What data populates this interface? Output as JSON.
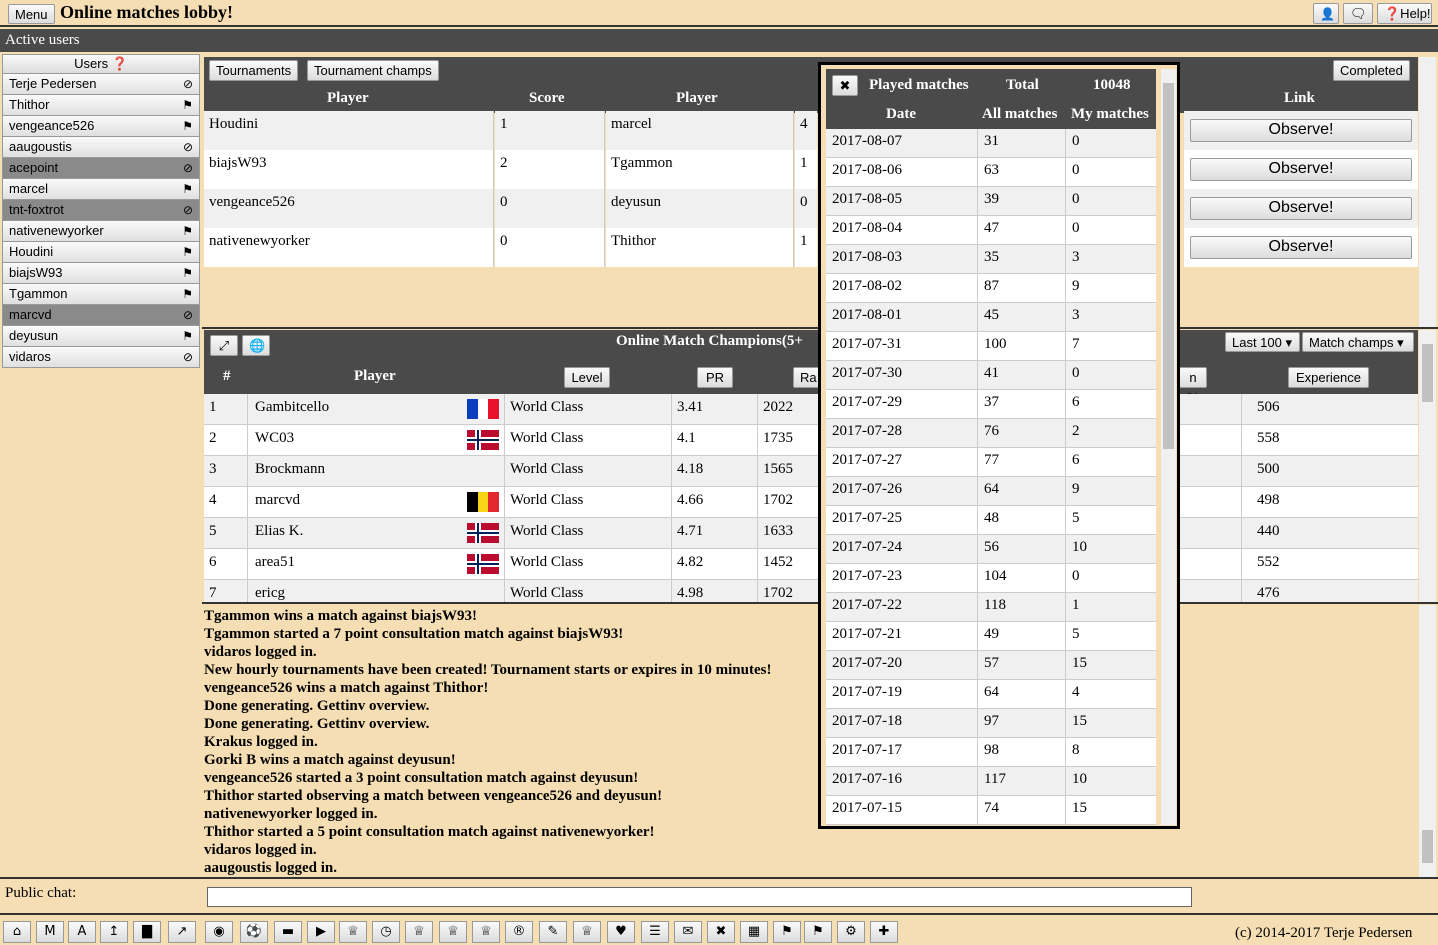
{
  "header": {
    "menu_label": "Menu",
    "title": "Online matches lobby!",
    "help_label": "❓Help!"
  },
  "active_users_label": "Active users",
  "users_header": "Users ❓",
  "users": [
    {
      "name": "Terje Pedersen",
      "icon": "⊘",
      "dark": false
    },
    {
      "name": "Thithor",
      "icon": "⚑",
      "dark": false
    },
    {
      "name": "vengeance526",
      "icon": "⚑",
      "dark": false
    },
    {
      "name": "aaugoustis",
      "icon": "⊘",
      "dark": false
    },
    {
      "name": "acepoint",
      "icon": "⊘",
      "dark": true
    },
    {
      "name": "marcel",
      "icon": "⚑",
      "dark": false
    },
    {
      "name": "tnt-foxtrot",
      "icon": "⊘",
      "dark": true
    },
    {
      "name": "nativenewyorker",
      "icon": "⚑",
      "dark": false
    },
    {
      "name": "Houdini",
      "icon": "⚑",
      "dark": false
    },
    {
      "name": "biajsW93",
      "icon": "⚑",
      "dark": false
    },
    {
      "name": "Tgammon",
      "icon": "⚑",
      "dark": false
    },
    {
      "name": "marcvd",
      "icon": "⊘",
      "dark": true
    },
    {
      "name": "deyusun",
      "icon": "⚑",
      "dark": false
    },
    {
      "name": "vidaros",
      "icon": "⊘",
      "dark": false
    }
  ],
  "matches": {
    "tab_tournaments": "Tournaments",
    "tab_champs": "Tournament champs",
    "completed": "Completed",
    "col_player1": "Player",
    "col_score": "Score",
    "col_player2": "Player",
    "col_link": "Link",
    "observe_label": "Observe!",
    "rows": [
      {
        "p1": "Houdini",
        "s1": "1",
        "p2": "marcel",
        "s2": "4"
      },
      {
        "p1": "biajsW93",
        "s1": "2",
        "p2": "Tgammon",
        "s2": "1"
      },
      {
        "p1": "vengeance526",
        "s1": "0",
        "p2": "deyusun",
        "s2": "0"
      },
      {
        "p1": "nativenewyorker",
        "s1": "0",
        "p2": "Thithor",
        "s2": "1"
      }
    ]
  },
  "champs": {
    "title": "Online Match Champions(5+",
    "select1": "Last 100 ▾",
    "select2": "Match champs ▾",
    "col_num": "#",
    "col_player": "Player",
    "btn_level": "Level",
    "btn_pr": "PR",
    "btn_ra": "Ra",
    "btn_pct": "n %",
    "btn_exp": "Experience",
    "rows": [
      {
        "n": "1",
        "player": "Gambitcello",
        "flag": "fr",
        "level": "World Class",
        "pr": "3.41",
        "ra": "2022",
        "exp": "506"
      },
      {
        "n": "2",
        "player": "WC03",
        "flag": "no",
        "level": "World Class",
        "pr": "4.1",
        "ra": "1735",
        "exp": "558"
      },
      {
        "n": "3",
        "player": "Brockmann",
        "flag": "",
        "level": "World Class",
        "pr": "4.18",
        "ra": "1565",
        "exp": "500"
      },
      {
        "n": "4",
        "player": "marcvd",
        "flag": "be",
        "level": "World Class",
        "pr": "4.66",
        "ra": "1702",
        "exp": "498"
      },
      {
        "n": "5",
        "player": "Elias K.",
        "flag": "no",
        "level": "World Class",
        "pr": "4.71",
        "ra": "1633",
        "exp": "440"
      },
      {
        "n": "6",
        "player": "area51",
        "flag": "no",
        "level": "World Class",
        "pr": "4.82",
        "ra": "1452",
        "exp": "552"
      },
      {
        "n": "7",
        "player": "ericg",
        "flag": "",
        "level": "World Class",
        "pr": "4.98",
        "ra": "1702",
        "exp": "476"
      }
    ]
  },
  "log": [
    "Tgammon wins a match against biajsW93!",
    "Tgammon started a 7 point consultation match against biajsW93!",
    "vidaros logged in.",
    "New hourly tournaments have been created! Tournament starts or expires in 10 minutes!",
    "vengeance526 wins a match against Thithor!",
    "Done generating. Gettinv overview.",
    "Done generating. Gettinv overview.",
    "Krakus logged in.",
    "Gorki B wins a match against deyusun!",
    "vengeance526 started a 3 point consultation match against deyusun!",
    "Thithor started observing a match between vengeance526 and deyusun!",
    "nativenewyorker logged in.",
    "Thithor started a 5 point consultation match against nativenewyorker!",
    "vidaros logged in.",
    "aaugoustis logged in."
  ],
  "chat": {
    "label": "Public chat:",
    "value": ""
  },
  "played": {
    "close": "✖",
    "title": "Played matches",
    "total_label": "Total",
    "total": "10048",
    "col_date": "Date",
    "col_all": "All matches",
    "col_my": "My matches",
    "rows": [
      [
        "2017-08-07",
        "31",
        "0"
      ],
      [
        "2017-08-06",
        "63",
        "0"
      ],
      [
        "2017-08-05",
        "39",
        "0"
      ],
      [
        "2017-08-04",
        "47",
        "0"
      ],
      [
        "2017-08-03",
        "35",
        "3"
      ],
      [
        "2017-08-02",
        "87",
        "9"
      ],
      [
        "2017-08-01",
        "45",
        "3"
      ],
      [
        "2017-07-31",
        "100",
        "7"
      ],
      [
        "2017-07-30",
        "41",
        "0"
      ],
      [
        "2017-07-29",
        "37",
        "6"
      ],
      [
        "2017-07-28",
        "76",
        "2"
      ],
      [
        "2017-07-27",
        "77",
        "6"
      ],
      [
        "2017-07-26",
        "64",
        "9"
      ],
      [
        "2017-07-25",
        "48",
        "5"
      ],
      [
        "2017-07-24",
        "56",
        "10"
      ],
      [
        "2017-07-23",
        "104",
        "0"
      ],
      [
        "2017-07-22",
        "118",
        "1"
      ],
      [
        "2017-07-21",
        "49",
        "5"
      ],
      [
        "2017-07-20",
        "57",
        "15"
      ],
      [
        "2017-07-19",
        "64",
        "4"
      ],
      [
        "2017-07-18",
        "97",
        "15"
      ],
      [
        "2017-07-17",
        "98",
        "8"
      ],
      [
        "2017-07-16",
        "117",
        "10"
      ],
      [
        "2017-07-15",
        "74",
        "15"
      ]
    ]
  },
  "toolbar": [
    "⌂",
    "M",
    "A",
    "↥",
    "▇",
    "↗",
    "◉",
    "⚽",
    "▬",
    "▶",
    "♕",
    "◷",
    "♕",
    "♕",
    "♕",
    "®",
    "✎",
    "♕",
    "♥",
    "☰",
    "✉",
    "✖",
    "▦",
    "⚑",
    "⚑",
    "⚙",
    "✚"
  ],
  "copyright": "(c) 2014-2017 Terje Pedersen"
}
